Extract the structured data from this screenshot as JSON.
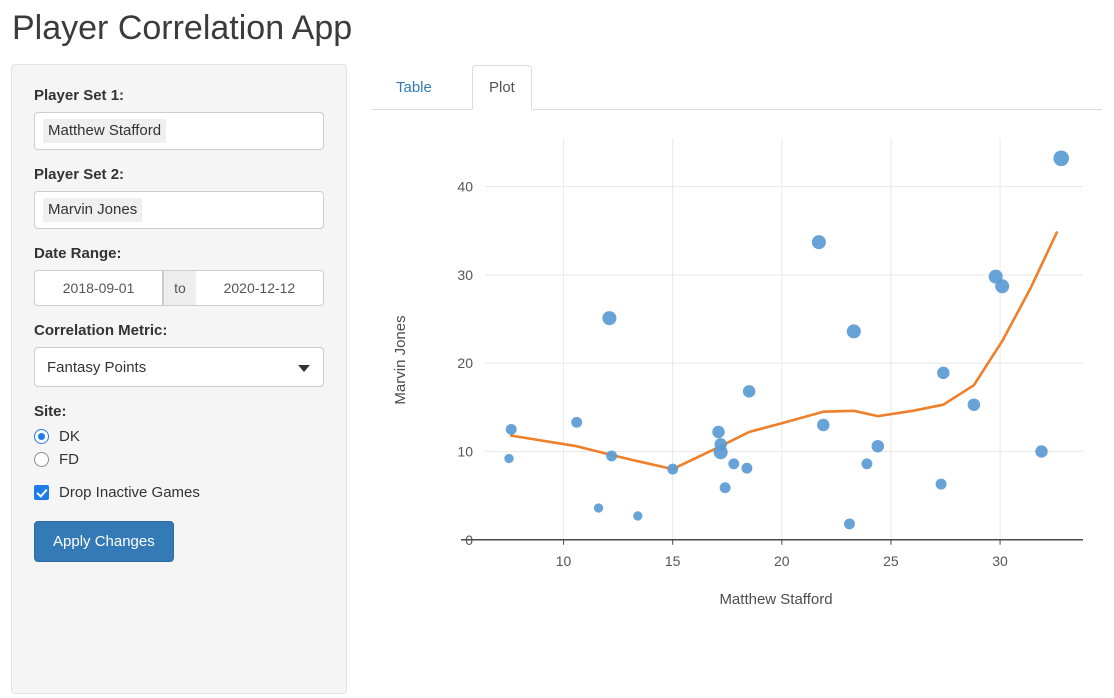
{
  "app": {
    "title": "Player Correlation App"
  },
  "sidebar": {
    "player_set_1": {
      "label": "Player Set 1:",
      "value": "Matthew Stafford"
    },
    "player_set_2": {
      "label": "Player Set 2:",
      "value": "Marvin Jones"
    },
    "date_range": {
      "label": "Date Range:",
      "start": "2018-09-01",
      "separator": "to",
      "end": "2020-12-12"
    },
    "correlation_metric": {
      "label": "Correlation Metric:",
      "value": "Fantasy Points",
      "caret_icon": "chevron-down-icon"
    },
    "site": {
      "label": "Site:",
      "options": [
        {
          "label": "DK",
          "selected": true
        },
        {
          "label": "FD",
          "selected": false
        }
      ]
    },
    "drop_inactive": {
      "label": "Drop Inactive Games",
      "checked": true
    },
    "apply_button": "Apply Changes"
  },
  "tabs": [
    {
      "label": "Table",
      "active": false
    },
    {
      "label": "Plot",
      "active": true
    }
  ],
  "colors": {
    "point": "#5b9bd5",
    "trend": "#ef7f28",
    "grid": "#e8e8e8",
    "axis": "#4d4d4d",
    "accent": "#337ab7",
    "panel": "#f5f5f5"
  },
  "chart_data": {
    "type": "scatter",
    "title": "",
    "xlabel": "Matthew Stafford",
    "ylabel": "Marvin Jones",
    "xlim": [
      6.4,
      33.8
    ],
    "ylim": [
      -1.5,
      45.5
    ],
    "xticks": [
      10,
      15,
      20,
      25,
      30
    ],
    "yticks": [
      0,
      10,
      20,
      30,
      40
    ],
    "grid": true,
    "legend": "none",
    "series": [
      {
        "name": "Games",
        "type": "scatter",
        "color": "#5b9bd5",
        "points": [
          {
            "x": 7.6,
            "y": 12.5,
            "size": 7
          },
          {
            "x": 7.5,
            "y": 9.2,
            "size": 6
          },
          {
            "x": 10.6,
            "y": 13.3,
            "size": 7
          },
          {
            "x": 11.6,
            "y": 3.6,
            "size": 6
          },
          {
            "x": 12.1,
            "y": 25.1,
            "size": 9
          },
          {
            "x": 12.2,
            "y": 9.5,
            "size": 7
          },
          {
            "x": 13.4,
            "y": 2.7,
            "size": 6
          },
          {
            "x": 15.0,
            "y": 8.0,
            "size": 7
          },
          {
            "x": 17.1,
            "y": 12.2,
            "size": 8
          },
          {
            "x": 17.2,
            "y": 10.8,
            "size": 8
          },
          {
            "x": 17.2,
            "y": 9.9,
            "size": 9
          },
          {
            "x": 17.4,
            "y": 5.9,
            "size": 7
          },
          {
            "x": 17.8,
            "y": 8.6,
            "size": 7
          },
          {
            "x": 18.4,
            "y": 8.1,
            "size": 7
          },
          {
            "x": 18.5,
            "y": 16.8,
            "size": 8
          },
          {
            "x": 21.7,
            "y": 33.7,
            "size": 9
          },
          {
            "x": 21.9,
            "y": 13.0,
            "size": 8
          },
          {
            "x": 23.1,
            "y": 1.8,
            "size": 7
          },
          {
            "x": 23.3,
            "y": 23.6,
            "size": 9
          },
          {
            "x": 23.9,
            "y": 8.6,
            "size": 7
          },
          {
            "x": 24.4,
            "y": 10.6,
            "size": 8
          },
          {
            "x": 27.3,
            "y": 6.3,
            "size": 7
          },
          {
            "x": 27.4,
            "y": 18.9,
            "size": 8
          },
          {
            "x": 28.8,
            "y": 15.3,
            "size": 8
          },
          {
            "x": 29.8,
            "y": 29.8,
            "size": 9
          },
          {
            "x": 30.1,
            "y": 28.7,
            "size": 9
          },
          {
            "x": 31.9,
            "y": 10.0,
            "size": 8
          },
          {
            "x": 32.8,
            "y": 43.2,
            "size": 10
          }
        ]
      },
      {
        "name": "Trend",
        "type": "line",
        "color": "#ef7f28",
        "points": [
          {
            "x": 7.6,
            "y": 11.8
          },
          {
            "x": 10.6,
            "y": 10.6
          },
          {
            "x": 12.2,
            "y": 9.6
          },
          {
            "x": 13.4,
            "y": 8.9
          },
          {
            "x": 15.0,
            "y": 8.0
          },
          {
            "x": 17.2,
            "y": 10.6
          },
          {
            "x": 18.5,
            "y": 12.2
          },
          {
            "x": 20.0,
            "y": 13.2
          },
          {
            "x": 21.9,
            "y": 14.5
          },
          {
            "x": 23.3,
            "y": 14.6
          },
          {
            "x": 24.4,
            "y": 14.0
          },
          {
            "x": 26.0,
            "y": 14.6
          },
          {
            "x": 27.4,
            "y": 15.3
          },
          {
            "x": 28.8,
            "y": 17.5
          },
          {
            "x": 30.1,
            "y": 22.5
          },
          {
            "x": 31.4,
            "y": 28.5
          },
          {
            "x": 32.6,
            "y": 34.8
          }
        ]
      }
    ]
  }
}
